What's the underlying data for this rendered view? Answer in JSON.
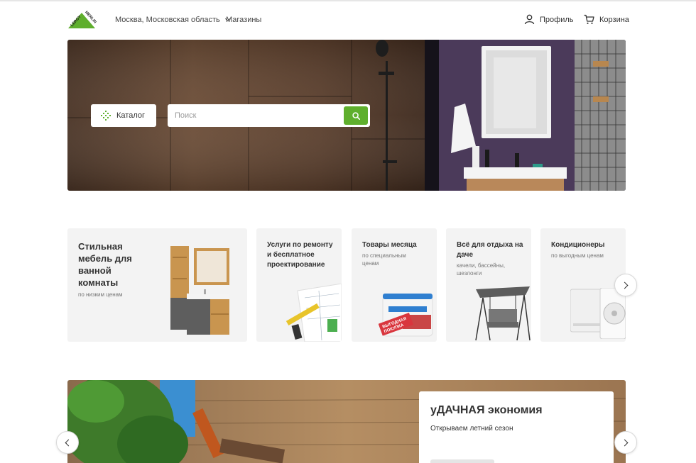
{
  "header": {
    "logo_text": "LEROY MERLIN",
    "region": "Москва, Московская область",
    "stores": "Магазины",
    "profile": "Профиль",
    "cart": "Корзина"
  },
  "hero": {
    "catalog_label": "Каталог",
    "search_placeholder": "Поиск"
  },
  "cards": [
    {
      "title": "Стильная мебель для ванной комнаты",
      "subtitle": "по низким ценам"
    },
    {
      "title": "Услуги по ремонту и бесплатное проектирование",
      "subtitle": ""
    },
    {
      "title": "Товары месяца",
      "subtitle": "по специальным ценам",
      "badge": "ВЫГОДНАЯ ПОКУПКА"
    },
    {
      "title": "Всё для отдыха на даче",
      "subtitle": "качели, бассейны, шезлонги"
    },
    {
      "title": "Кондиционеры",
      "subtitle": "по выгодным ценам"
    }
  ],
  "promo": {
    "title": "уДАЧНАЯ экономия",
    "subtitle": "Открываем летний сезон"
  },
  "colors": {
    "brand_green": "#5faf2d",
    "card_bg": "#f3f3f3",
    "text": "#333333"
  },
  "icons": [
    "logo-triangle",
    "chevron-down-icon",
    "user-icon",
    "cart-icon",
    "catalog-icon",
    "search-icon",
    "chevron-right-icon",
    "chevron-left-icon"
  ]
}
